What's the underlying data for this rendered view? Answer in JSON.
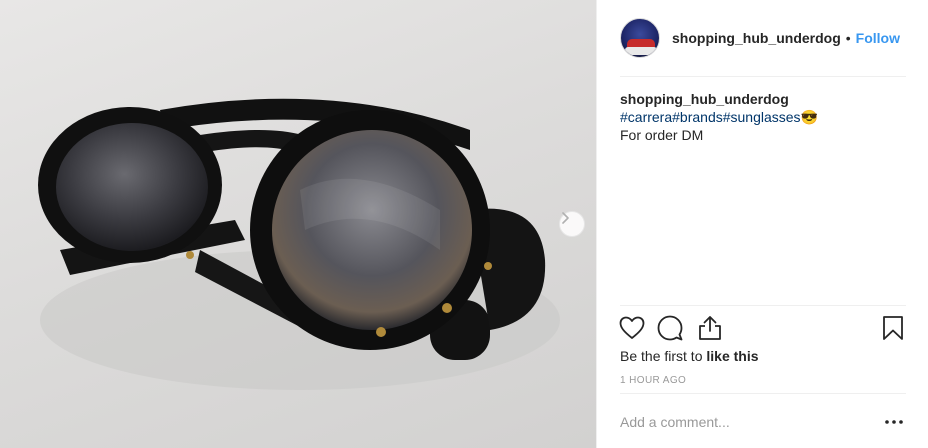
{
  "post": {
    "media_alt": "Photo of black round Carrera sunglasses with side shields",
    "next_icon": "chevron-right-icon"
  },
  "header": {
    "username": "shopping_hub_underdog",
    "separator": "•",
    "follow_label": "Follow"
  },
  "caption": {
    "username": "shopping_hub_underdog",
    "hashtags": [
      "#carrera",
      "#brands",
      "#sunglasses"
    ],
    "emoji": "😎",
    "text": "For order DM"
  },
  "actions": {
    "icons": [
      "heart-icon",
      "comment-icon",
      "share-icon",
      "bookmark-icon"
    ]
  },
  "likes": {
    "prefix": "Be the first to ",
    "link": "like this"
  },
  "timestamp": "1 HOUR AGO",
  "comment": {
    "placeholder": "Add a comment...",
    "more_icon": "more-options-icon"
  },
  "colors": {
    "link_blue": "#3897f0",
    "hashtag": "#003569",
    "muted": "#999999",
    "text": "#262626",
    "divider": "#efefef"
  }
}
